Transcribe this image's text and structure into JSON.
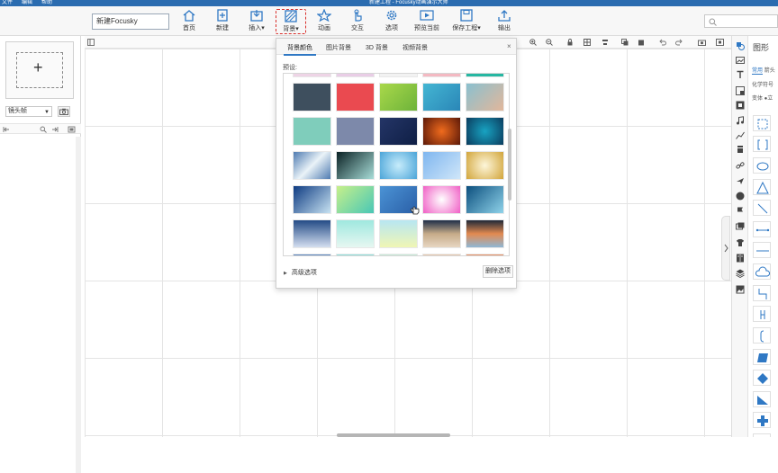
{
  "titlebar": {
    "menu": [
      "文件",
      "编辑",
      "帮助"
    ],
    "title": "新建工程 - Focusky动画演示大师"
  },
  "toolbar": {
    "project_name": "新建Focusky",
    "buttons": [
      {
        "label": "首页",
        "icon": "home-icon"
      },
      {
        "label": "新建",
        "icon": "new-file-icon"
      },
      {
        "label": "插入",
        "icon": "insert-icon",
        "dropdown": true
      },
      {
        "label": "背景",
        "icon": "background-icon",
        "dropdown": true,
        "active": true
      },
      {
        "label": "动画",
        "icon": "star-animation-icon"
      },
      {
        "label": "交互",
        "icon": "hand-interact-icon"
      },
      {
        "label": "选项",
        "icon": "gear-icon"
      },
      {
        "label": "预览当前",
        "icon": "preview-icon"
      },
      {
        "label": "保存工程",
        "icon": "save-icon",
        "dropdown": true
      },
      {
        "label": "输出",
        "icon": "export-icon"
      }
    ]
  },
  "left_panel": {
    "add_frame_symbol": "+",
    "lens_frame_label": "镜头帧"
  },
  "right_panel": {
    "title": "图形",
    "tabs": [
      "常用",
      "箭头"
    ],
    "line2": "化学符号",
    "line3": "变体  ●立"
  },
  "background_popup": {
    "tabs": [
      "背景颜色",
      "图片背景",
      "3D 背景",
      "视频背景"
    ],
    "selected_tab": 0,
    "close": "×",
    "preset_label": "预设:",
    "advanced_label": "高级选项",
    "delete_label": "删除选项",
    "swatch_rows": [
      [
        "linear-gradient(#eed4e6,#eed4e6)",
        "linear-gradient(#e9cde6,#e9cde6)",
        "linear-gradient(#f2f2f2,#f2f2f2)",
        "linear-gradient(#f4b9c2,#f4b9c2)",
        "linear-gradient(#26b7a2,#26b7a2)"
      ],
      [
        "linear-gradient(#3e4f5e,#3e4f5e)",
        "linear-gradient(#ea4a50,#ea4a50)",
        "linear-gradient(135deg,#a9d84a,#6db33a)",
        "linear-gradient(135deg,#44b6d3,#2a86b7)",
        "linear-gradient(135deg,#8ac0cf,#e2b79b)"
      ],
      [
        "linear-gradient(#7fcdbb,#7fcdbb)",
        "linear-gradient(#7d89aa,#7d89aa)",
        "linear-gradient(135deg,#243567,#0f1f45)",
        "radial-gradient(circle,#f06b1d,#5b1808)",
        "radial-gradient(circle,#18a3c2,#0b3c5e)"
      ],
      [
        "linear-gradient(135deg,#4f7bb1,#eaf3f8,#4f7bb1)",
        "linear-gradient(135deg,#0b2124,#a8ddd8)",
        "radial-gradient(circle,#c7ecfb,#4aa4d8)",
        "linear-gradient(135deg,#7fb6ef,#cfe6f9)",
        "radial-gradient(circle,#fdf6da,#d2a53a)"
      ],
      [
        "linear-gradient(135deg,#0e3b82,#c7e2f2)",
        "linear-gradient(135deg,#c7f08a,#49c7b6)",
        "linear-gradient(135deg,#4b93d5,#2a5fa7)",
        "radial-gradient(circle,#ffffff,#f05ec5)",
        "linear-gradient(135deg,#0c4f7e,#8fd3ea)"
      ],
      [
        "linear-gradient(#234b86,#d4def0)",
        "linear-gradient(#9fe8df,#e6f7f1)",
        "linear-gradient(#b7e6f2,#f0f6b4)",
        "linear-gradient(#1f2e48,#c6ab88,#e7d6c2)",
        "linear-gradient(#1e2837,#e38a50,#8fb7d4)"
      ],
      [
        "linear-gradient(#5b85bf,#5b85bf)",
        "linear-gradient(#8fe0dc,#8fe0dc)",
        "linear-gradient(#c8ecd8,#c8ecd8)",
        "linear-gradient(#e8c9ad,#e8c9ad)",
        "linear-gradient(#e79066,#e79066)"
      ]
    ]
  }
}
